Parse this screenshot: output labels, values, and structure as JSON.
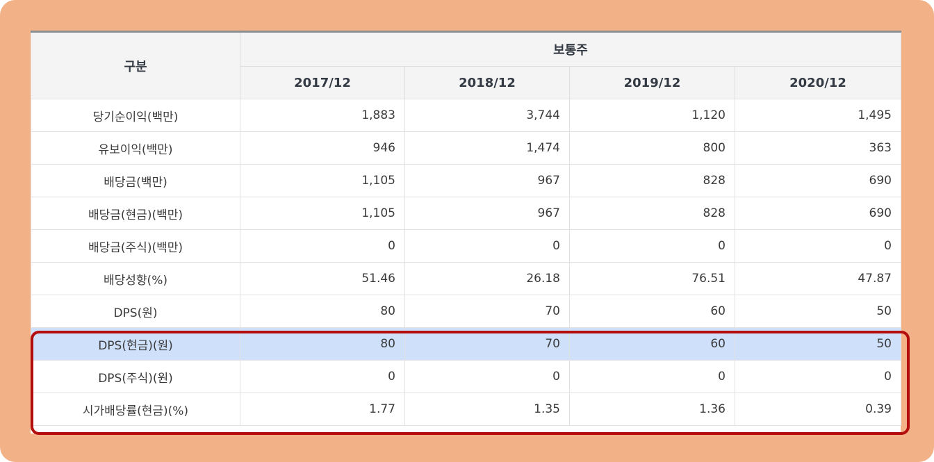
{
  "table": {
    "corner_header": "구분",
    "group_header": "보통주",
    "years": [
      "2017/12",
      "2018/12",
      "2019/12",
      "2020/12"
    ],
    "rows": [
      {
        "label": "당기순이익(백만)",
        "values": [
          "1,883",
          "3,744",
          "1,120",
          "1,495"
        ]
      },
      {
        "label": "유보이익(백만)",
        "values": [
          "946",
          "1,474",
          "800",
          "363"
        ]
      },
      {
        "label": "배당금(백만)",
        "values": [
          "1,105",
          "967",
          "828",
          "690"
        ]
      },
      {
        "label": "배당금(현금)(백만)",
        "values": [
          "1,105",
          "967",
          "828",
          "690"
        ]
      },
      {
        "label": "배당금(주식)(백만)",
        "values": [
          "0",
          "0",
          "0",
          "0"
        ]
      },
      {
        "label": "배당성향(%)",
        "values": [
          "51.46",
          "26.18",
          "76.51",
          "47.87"
        ]
      },
      {
        "label": "DPS(원)",
        "values": [
          "80",
          "70",
          "60",
          "50"
        ]
      },
      {
        "label": "DPS(현금)(원)",
        "values": [
          "80",
          "70",
          "60",
          "50"
        ]
      },
      {
        "label": "DPS(주식)(원)",
        "values": [
          "0",
          "0",
          "0",
          "0"
        ]
      },
      {
        "label": "시가배당률(현금)(%)",
        "values": [
          "1.77",
          "1.35",
          "1.36",
          "0.39"
        ]
      }
    ]
  },
  "colors": {
    "frame_background": "#f3b187",
    "highlight_row": "#cfe0fb",
    "annotation_box": "#b30d0d"
  },
  "highlighted_row_index": 7
}
